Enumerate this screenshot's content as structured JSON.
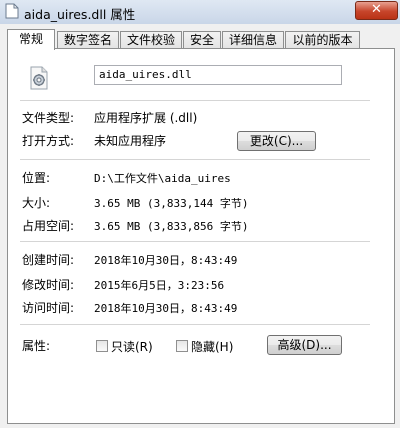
{
  "window": {
    "title": "aida_uires.dll 属性",
    "close_label": "✕",
    "title_icon": "document-icon"
  },
  "tabs": [
    {
      "label": "常规",
      "active": true
    },
    {
      "label": "数字签名"
    },
    {
      "label": "文件校验"
    },
    {
      "label": "安全"
    },
    {
      "label": "详细信息"
    },
    {
      "label": "以前的版本"
    }
  ],
  "file": {
    "name": "aida_uires.dll",
    "icon": "dll-gear-icon"
  },
  "info": {
    "type_label": "文件类型:",
    "type_value": "应用程序扩展 (.dll)",
    "opens_label": "打开方式:",
    "opens_value": "未知应用程序",
    "change_button": "更改(C)...",
    "location_label": "位置:",
    "location_value": "D:\\工作文件\\aida_uires",
    "size_label": "大小:",
    "size_value": "3.65 MB (3,833,144 字节)",
    "disk_label": "占用空间:",
    "disk_value": "3.65 MB (3,833,856 字节)",
    "created_label": "创建时间:",
    "created_value": "2018年10月30日，8:43:49",
    "modified_label": "修改时间:",
    "modified_value": "2015年6月5日，3:23:56",
    "accessed_label": "访问时间:",
    "accessed_value": "2018年10月30日，8:43:49",
    "attr_label": "属性:",
    "readonly_label": "只读(R)",
    "readonly_checked": false,
    "hidden_label": "隐藏(H)",
    "hidden_checked": false,
    "advanced_button": "高级(D)..."
  }
}
